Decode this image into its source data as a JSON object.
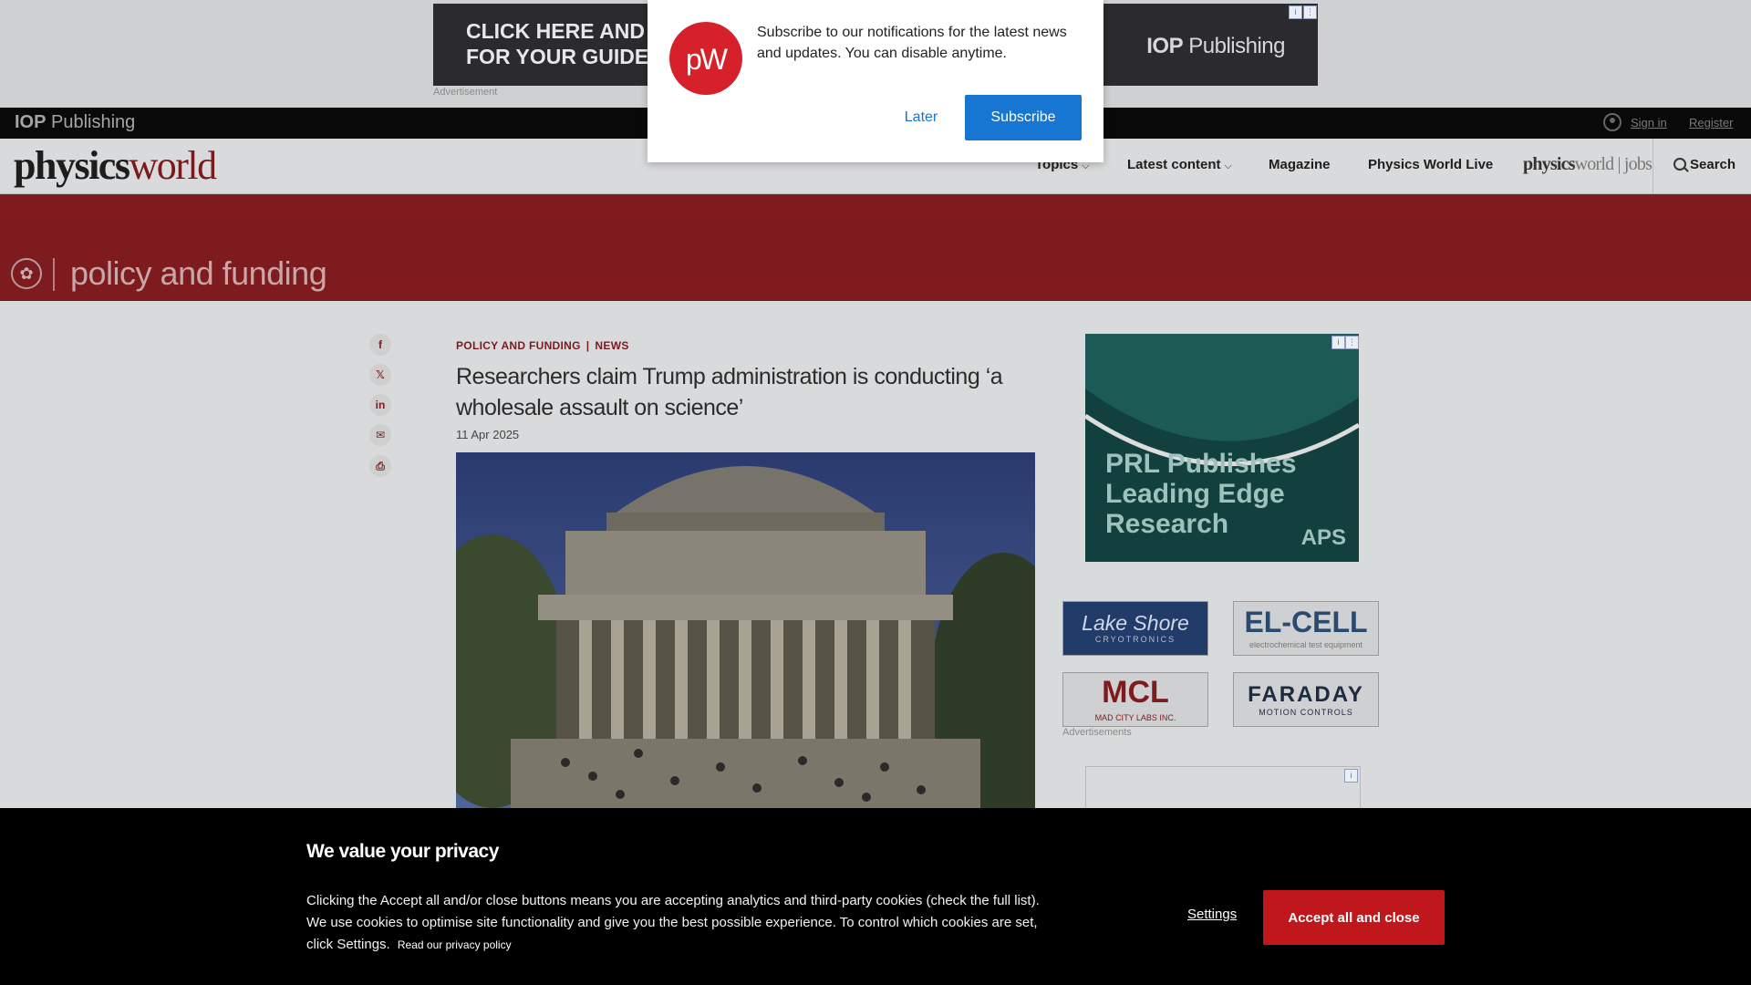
{
  "colors": {
    "brand_red": "#7d1b1e",
    "accept_red": "#c0171d",
    "subscribe_blue": "#1676d2",
    "notif_logo_red": "#d6202a",
    "overlay_bg": "#d9dadb"
  },
  "top_ad": {
    "cta_line1": "CLICK HERE AND S",
    "cta_line2": "FOR YOUR GUIDE!",
    "brand_bold": "IOP",
    "brand_rest": " Publishing",
    "label": "Advertisement"
  },
  "iop_bar": {
    "logo_bold": "IOP",
    "logo_rest": " Publishing",
    "sign_in": "Sign in",
    "register": "Register",
    "user_icon": "user-icon"
  },
  "nav": {
    "logo_part1": "physics",
    "logo_part2": "world",
    "items": [
      {
        "label": "Topics",
        "icon": "chevron-down-icon"
      },
      {
        "label": "Latest content",
        "icon": "chevron-down-icon"
      },
      {
        "label": "Magazine"
      },
      {
        "label": "Physics World Live"
      }
    ],
    "jobs_logo_part1": "physics",
    "jobs_logo_part2": "world | jobs",
    "search_label": "Search"
  },
  "section": {
    "title": "policy and funding",
    "icon": "topic-icon"
  },
  "share": [
    "facebook-icon",
    "x-icon",
    "linkedin-icon",
    "email-icon",
    "print-icon"
  ],
  "article": {
    "tag1": "POLICY AND FUNDING",
    "tag2": "NEWS",
    "title": "Researchers claim Trump administration is conducting ‘a wholesale assault on science’",
    "date": "11 Apr 2025"
  },
  "right_ads": {
    "main_text_line1": "PRL Publishes",
    "main_text_line2": "Leading Edge",
    "main_text_line3": "Research",
    "main_brand": "APS",
    "tiles": [
      {
        "name": "Lake Shore",
        "sub": "CRYOTRONICS"
      },
      {
        "name": "EL-CELL",
        "sub": "electrochemical test equipment"
      },
      {
        "name": "MCL",
        "sub": "MAD CITY LABS INC."
      },
      {
        "name": "FARADAY",
        "sub": "MOTION CONTROLS"
      }
    ],
    "label": "Advertisements"
  },
  "notification": {
    "logo_p": "p",
    "logo_w": "W",
    "message": "Subscribe to our notifications for the latest news and updates. You can disable anytime.",
    "later": "Later",
    "subscribe": "Subscribe"
  },
  "cookie": {
    "title": "We value your privacy",
    "text": "Clicking the Accept all and/or close buttons means you are accepting analytics and third-party cookies (check the full list). We use cookies to optimise site functionality and give you the best possible experience. To control which cookies are set, click Settings.",
    "policy_link": "Read our privacy policy",
    "settings": "Settings",
    "accept": "Accept all and close"
  }
}
